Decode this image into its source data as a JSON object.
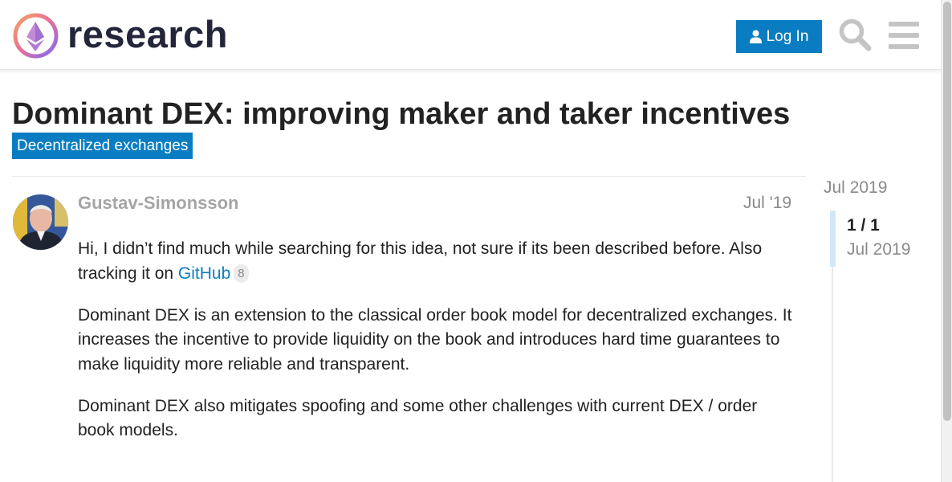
{
  "header": {
    "site_name": "research",
    "login_label": "Log In"
  },
  "topic": {
    "title": "Dominant DEX: improving maker and taker incentives",
    "category": "Decentralized exchanges"
  },
  "post": {
    "username": "Gustav-Simonsson",
    "date": "Jul '19",
    "paragraph1_before_link": "Hi, I didn’t find much while searching for this idea, not sure if its been described before. Also tracking it on ",
    "link_text": "GitHub",
    "link_clicks": "8",
    "paragraph2": "Dominant DEX is an extension to the classical order book model for decentralized exchanges. It increases the incentive to provide liquidity on the book and introduces hard time guarantees to make liquidity more reliable and transparent.",
    "paragraph3": "Dominant DEX also mitigates spoofing and some other challenges with current DEX / order book models."
  },
  "timeline": {
    "start_date": "Jul 2019",
    "position": "1 / 1",
    "current_date": "Jul 2019"
  },
  "colors": {
    "accent": "#0a7dc2",
    "muted_text": "#8a8a8a",
    "username": "#a5a5a5"
  }
}
